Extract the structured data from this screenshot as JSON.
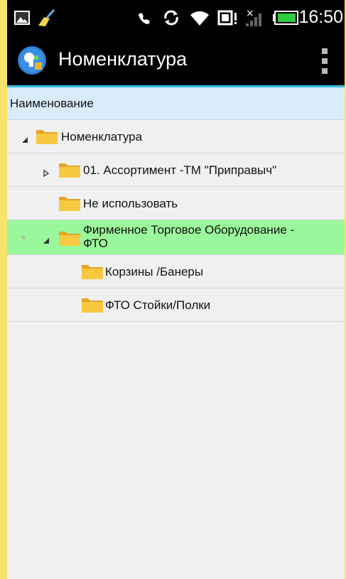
{
  "status_bar": {
    "time": "16:50",
    "icons": [
      "image-notification-icon",
      "cleaner-icon",
      "call-forward-icon",
      "sync-icon",
      "wifi-icon",
      "storage-alert-icon",
      "no-signal-icon",
      "battery-icon"
    ]
  },
  "action_bar": {
    "title": "Номенклатура",
    "logo_icon": "app-logo-icon",
    "menu_icon": "overflow-menu-icon"
  },
  "tree": {
    "column_header": "Наименование",
    "rows": [
      {
        "label": "Номенклатура",
        "level": 0,
        "expander": "expanded"
      },
      {
        "label": "01. Ассортимент -ТМ \"Приправыч\"",
        "level": 1,
        "expander": "collapsed"
      },
      {
        "label": "Не использовать",
        "level": 1,
        "expander": "none"
      },
      {
        "label_line1": "Фирменное Торговое Оборудование  -",
        "label_line2": "ФТО",
        "level": 1,
        "expander": "expanded",
        "selected": true
      },
      {
        "label": "Корзины /Банеры",
        "level": 2,
        "expander": "none"
      },
      {
        "label": "ФТО Стойки/Полки",
        "level": 2,
        "expander": "none"
      }
    ]
  },
  "colors": {
    "accent": "#33b5e5",
    "selected_row": "#9af79b",
    "header_bg": "#d9ecfc",
    "folder": "#f6c53c",
    "frame": "#f7e36a"
  }
}
